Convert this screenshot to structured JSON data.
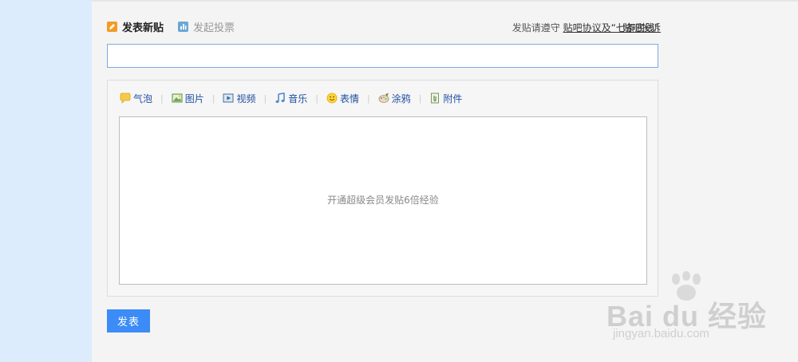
{
  "tabs": {
    "new_post": "发表新贴",
    "poll": "发起投票"
  },
  "rules": {
    "prefix": "发贴请遵守 ",
    "link": "贴吧协议及“七条底线”",
    "report": "贴吧投诉"
  },
  "title_input": {
    "value": "",
    "placeholder": ""
  },
  "toolbar": {
    "items": [
      {
        "label": "气泡",
        "icon": "bubble-icon"
      },
      {
        "label": "图片",
        "icon": "image-icon"
      },
      {
        "label": "视频",
        "icon": "video-icon"
      },
      {
        "label": "音乐",
        "icon": "music-icon"
      },
      {
        "label": "表情",
        "icon": "emoji-icon"
      },
      {
        "label": "涂鸦",
        "icon": "graffiti-icon"
      },
      {
        "label": "附件",
        "icon": "attachment-icon"
      }
    ],
    "separator": "|"
  },
  "editor": {
    "placeholder": "开通超级会员发贴6倍经验"
  },
  "submit_label": "发表",
  "watermark": {
    "brand": "Bai du 经验",
    "domain": "jingyan.baidu.com"
  },
  "colors": {
    "accent": "#3b8cf6",
    "left_strip": "#dcecfc",
    "link": "#1f4fa0"
  }
}
